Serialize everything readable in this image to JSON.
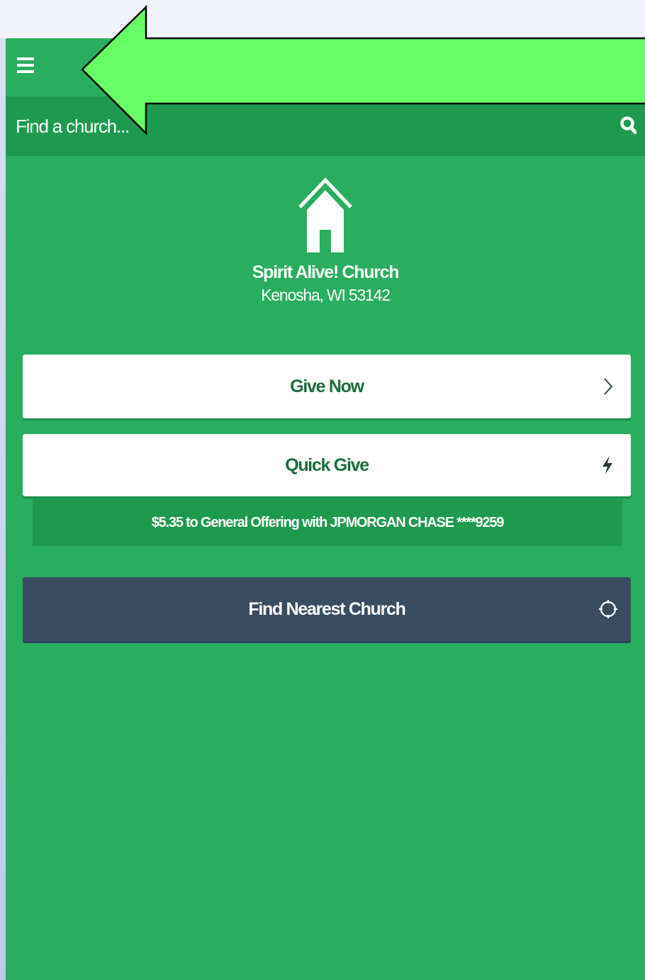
{
  "topbar": {
    "menu_icon": "hamburger-menu-icon"
  },
  "search": {
    "placeholder": "Find a church...",
    "search_icon": "search-icon"
  },
  "church": {
    "icon": "house-icon",
    "name": "Spirit Alive! Church",
    "location": "Kenosha, WI 53142"
  },
  "actions": {
    "give_now": {
      "label": "Give Now",
      "icon": "chevron-right-icon"
    },
    "quick_give": {
      "label": "Quick Give",
      "icon": "lightning-bolt-icon",
      "summary": "$5.35 to General Offering with JPMORGAN CHASE ****9259"
    },
    "find_nearest": {
      "label": "Find Nearest Church",
      "icon": "crosshair-icon"
    }
  },
  "annotation": {
    "icon": "green-arrow-annotation",
    "color": "#66ff66"
  },
  "colors": {
    "app_background": "#28ae5e",
    "search_bar": "#1e9a4f",
    "find_nearest_button": "#3a4c5f",
    "button_text": "#1c6d3c"
  }
}
